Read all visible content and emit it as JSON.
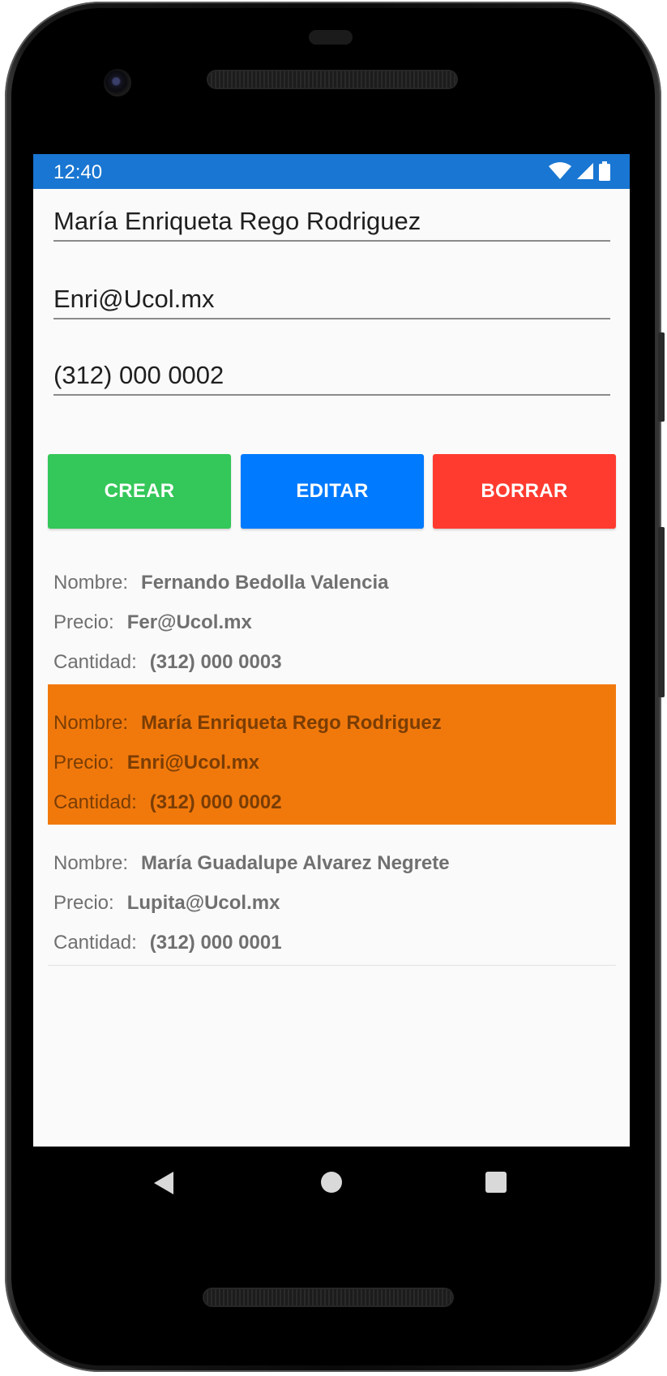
{
  "status_bar": {
    "time": "12:40",
    "icons": [
      "wifi-icon",
      "cell-signal-icon",
      "battery-icon"
    ],
    "background": "#1976d2"
  },
  "form": {
    "name_value": "María Enriqueta Rego Rodriguez",
    "email_value": "Enri@Ucol.mx",
    "phone_value": "(312) 000 0002"
  },
  "buttons": {
    "crear": "CREAR",
    "editar": "EDITAR",
    "borrar": "BORRAR",
    "colors": {
      "crear": "#34c759",
      "editar": "#007aff",
      "borrar": "#ff3b30"
    }
  },
  "list": {
    "label_nombre": "Nombre:",
    "label_precio": "Precio:",
    "label_cantidad": "Cantidad:",
    "selected_color": "#f1790c",
    "items": [
      {
        "nombre": "Fernando Bedolla Valencia",
        "precio": "Fer@Ucol.mx",
        "cantidad": "(312) 000 0003",
        "selected": false
      },
      {
        "nombre": "María Enriqueta Rego Rodriguez",
        "precio": "Enri@Ucol.mx",
        "cantidad": "(312) 000 0002",
        "selected": true
      },
      {
        "nombre": "María Guadalupe Alvarez Negrete",
        "precio": "Lupita@Ucol.mx",
        "cantidad": "(312) 000 0001",
        "selected": false
      }
    ]
  },
  "nav_bar": {
    "icons": [
      "back-icon",
      "home-icon",
      "recents-icon"
    ]
  }
}
